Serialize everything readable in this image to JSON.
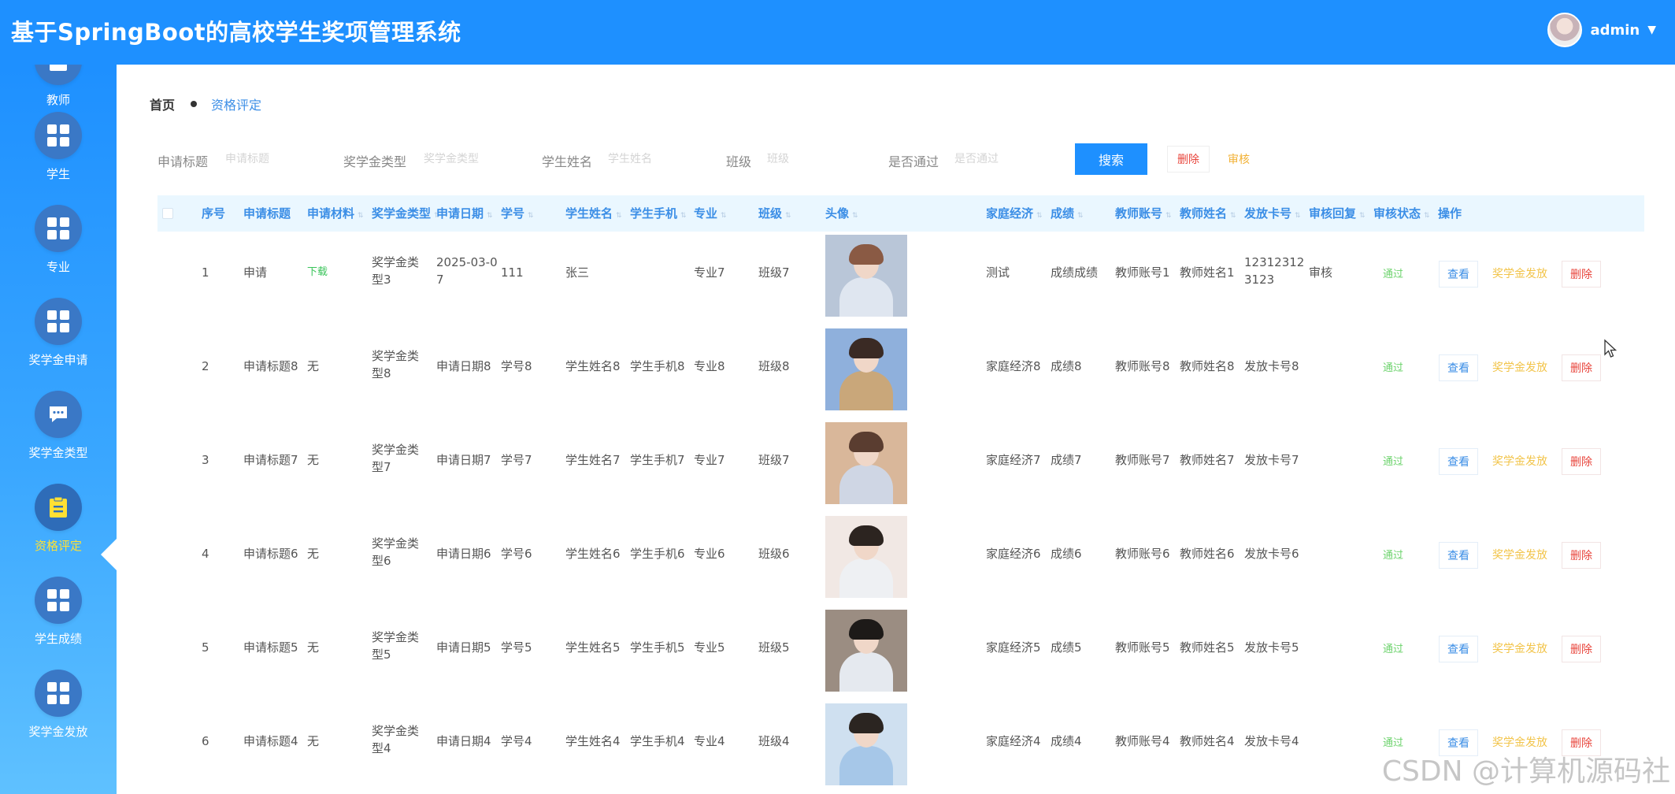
{
  "header": {
    "title": "基于SpringBoot的高校学生奖项管理系统",
    "user": "admin"
  },
  "sidebar": {
    "items": [
      {
        "label": "教师",
        "icon": "card-icon"
      },
      {
        "label": "学生",
        "icon": "grid-icon"
      },
      {
        "label": "专业",
        "icon": "grid-icon"
      },
      {
        "label": "奖学金申请",
        "icon": "grid-icon"
      },
      {
        "label": "奖学金类型",
        "icon": "chat-icon"
      },
      {
        "label": "资格评定",
        "icon": "clipboard-icon",
        "active": true
      },
      {
        "label": "学生成绩",
        "icon": "grid-icon"
      },
      {
        "label": "奖学金发放",
        "icon": "grid-icon"
      }
    ]
  },
  "breadcrumb": {
    "home": "首页",
    "current": "资格评定"
  },
  "search": {
    "fields": [
      {
        "label": "申请标题",
        "placeholder": "申请标题"
      },
      {
        "label": "奖学金类型",
        "placeholder": "奖学金类型"
      },
      {
        "label": "学生姓名",
        "placeholder": "学生姓名"
      },
      {
        "label": "班级",
        "placeholder": "班级"
      },
      {
        "label": "是否通过",
        "placeholder": "是否通过"
      }
    ],
    "search_button": "搜索",
    "delete_button": "删除",
    "audit_button": "审核"
  },
  "table": {
    "columns": [
      "序号",
      "申请标题",
      "申请材料",
      "奖学金类型",
      "申请日期",
      "学号",
      "学生姓名",
      "学生手机",
      "专业",
      "班级",
      "头像",
      "家庭经济",
      "成绩",
      "教师账号",
      "教师姓名",
      "发放卡号",
      "审核回复",
      "审核状态",
      "操作"
    ],
    "actions": {
      "view": "查看",
      "pay": "奖学金发放",
      "delete": "删除"
    },
    "rows": [
      {
        "no": "1",
        "title": "申请",
        "material": "下载",
        "type": "奖学金类型3",
        "date": "2025-03-07",
        "sid": "111",
        "name": "张三",
        "phone": "",
        "major": "专业7",
        "cls": "班级7",
        "economy": "测试",
        "score": "成绩成绩",
        "tacc": "教师账号1",
        "tname": "教师姓名1",
        "card": "123123123123",
        "reply": "审核",
        "status": "通过"
      },
      {
        "no": "2",
        "title": "申请标题8",
        "material": "无",
        "type": "奖学金类型8",
        "date": "申请日期8",
        "sid": "学号8",
        "name": "学生姓名8",
        "phone": "学生手机8",
        "major": "专业8",
        "cls": "班级8",
        "economy": "家庭经济8",
        "score": "成绩8",
        "tacc": "教师账号8",
        "tname": "教师姓名8",
        "card": "发放卡号8",
        "reply": "",
        "status": "通过"
      },
      {
        "no": "3",
        "title": "申请标题7",
        "material": "无",
        "type": "奖学金类型7",
        "date": "申请日期7",
        "sid": "学号7",
        "name": "学生姓名7",
        "phone": "学生手机7",
        "major": "专业7",
        "cls": "班级7",
        "economy": "家庭经济7",
        "score": "成绩7",
        "tacc": "教师账号7",
        "tname": "教师姓名7",
        "card": "发放卡号7",
        "reply": "",
        "status": "通过"
      },
      {
        "no": "4",
        "title": "申请标题6",
        "material": "无",
        "type": "奖学金类型6",
        "date": "申请日期6",
        "sid": "学号6",
        "name": "学生姓名6",
        "phone": "学生手机6",
        "major": "专业6",
        "cls": "班级6",
        "economy": "家庭经济6",
        "score": "成绩6",
        "tacc": "教师账号6",
        "tname": "教师姓名6",
        "card": "发放卡号6",
        "reply": "",
        "status": "通过"
      },
      {
        "no": "5",
        "title": "申请标题5",
        "material": "无",
        "type": "奖学金类型5",
        "date": "申请日期5",
        "sid": "学号5",
        "name": "学生姓名5",
        "phone": "学生手机5",
        "major": "专业5",
        "cls": "班级5",
        "economy": "家庭经济5",
        "score": "成绩5",
        "tacc": "教师账号5",
        "tname": "教师姓名5",
        "card": "发放卡号5",
        "reply": "",
        "status": "通过"
      },
      {
        "no": "6",
        "title": "申请标题4",
        "material": "无",
        "type": "奖学金类型4",
        "date": "申请日期4",
        "sid": "学号4",
        "name": "学生姓名4",
        "phone": "学生手机4",
        "major": "专业4",
        "cls": "班级4",
        "economy": "家庭经济4",
        "score": "成绩4",
        "tacc": "教师账号4",
        "tname": "教师姓名4",
        "card": "发放卡号4",
        "reply": "",
        "status": "通过"
      }
    ]
  },
  "watermark": "CSDN @计算机源码社",
  "colors": {
    "primary": "#1e90ff",
    "active_nav": "#ffe033",
    "pass": "#6dd36d",
    "danger": "#e8453c",
    "warning": "#f2c44a"
  }
}
